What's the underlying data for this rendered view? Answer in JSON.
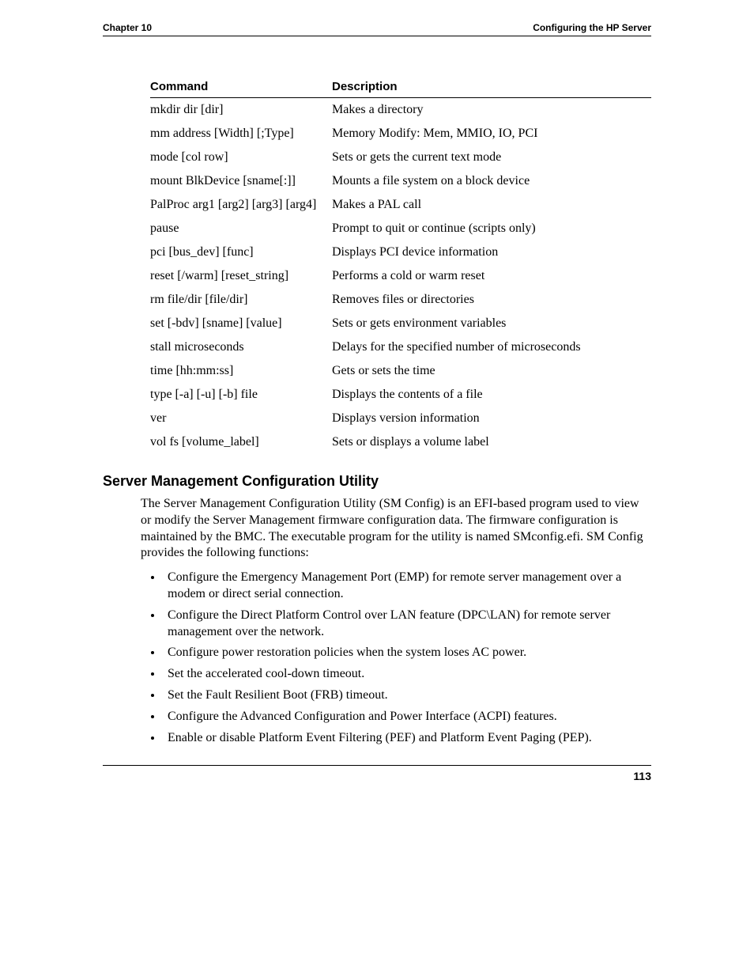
{
  "header": {
    "left": "Chapter 10",
    "right": "Configuring the HP Server"
  },
  "table": {
    "headers": {
      "c0": "Command",
      "c1": "Description"
    },
    "rows": [
      {
        "c0": "mkdir dir [dir]",
        "c1": "Makes a directory"
      },
      {
        "c0": "mm address [Width] [;Type]",
        "c1": "Memory Modify: Mem, MMIO, IO, PCI"
      },
      {
        "c0": "mode [col row]",
        "c1": "Sets or gets the current text mode"
      },
      {
        "c0": "mount BlkDevice [sname[:]]",
        "c1": "Mounts a file system on a block device"
      },
      {
        "c0": "PalProc arg1 [arg2] [arg3] [arg4]",
        "c1": "Makes a PAL call"
      },
      {
        "c0": "pause",
        "c1": "Prompt to quit or continue (scripts only)"
      },
      {
        "c0": "pci [bus_dev] [func]",
        "c1": "Displays PCI device information"
      },
      {
        "c0": "reset [/warm] [reset_string]",
        "c1": "Performs a cold or warm reset"
      },
      {
        "c0": "rm file/dir [file/dir]",
        "c1": "Removes files or directories"
      },
      {
        "c0": "set [-bdv] [sname] [value]",
        "c1": "Sets or gets environment variables"
      },
      {
        "c0": "stall microseconds",
        "c1": "Delays for the specified number of microseconds"
      },
      {
        "c0": "time [hh:mm:ss]",
        "c1": "Gets or sets the time"
      },
      {
        "c0": "type [-a] [-u] [-b] file",
        "c1": "Displays the contents of a file"
      },
      {
        "c0": "ver",
        "c1": "Displays version information"
      },
      {
        "c0": "vol fs [volume_label]",
        "c1": "Sets or displays a volume label"
      }
    ]
  },
  "section": {
    "title": "Server Management Configuration Utility",
    "intro": "The Server Management Configuration Utility (SM Config) is an EFI-based program used to view or modify the Server Management firmware configuration data.  The firmware configuration is maintained by the BMC.  The executable program for the utility is named SMconfig.efi. SM Config provides the following functions:",
    "bullets": [
      "Configure the Emergency Management Port (EMP) for remote server management over a modem or direct serial connection.",
      "Configure the Direct Platform Control over LAN feature (DPC\\LAN) for remote server management over the network.",
      "Configure power restoration policies when the system loses AC power.",
      "Set the accelerated cool-down timeout.",
      "Set the Fault Resilient Boot (FRB) timeout.",
      "Configure the Advanced Configuration and Power Interface (ACPI) features.",
      "Enable or disable Platform Event Filtering (PEF) and Platform Event Paging (PEP)."
    ]
  },
  "footer": {
    "page_number": "113"
  }
}
